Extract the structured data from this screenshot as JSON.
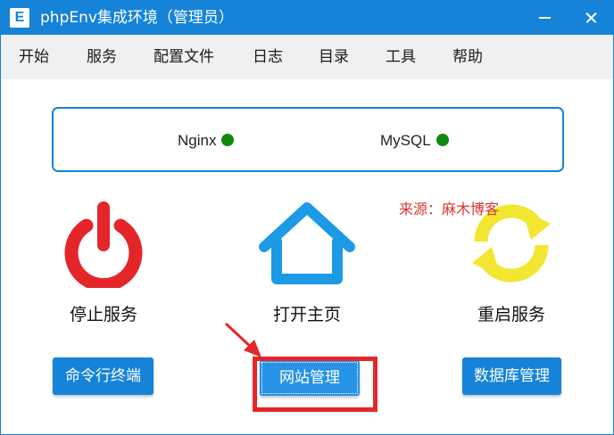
{
  "window": {
    "title": "phpEnv集成环境（管理员）",
    "app_icon_letter": "E"
  },
  "menu": {
    "items": [
      "开始",
      "服务",
      "配置文件",
      "日志",
      "目录",
      "工具",
      "帮助"
    ]
  },
  "services": [
    {
      "name": "Nginx",
      "status": "running",
      "status_color": "#108a0e"
    },
    {
      "name": "MySQL",
      "status": "running",
      "status_color": "#108a0e"
    }
  ],
  "actions": {
    "stop": {
      "label": "停止服务",
      "icon": "power-icon",
      "color": "#e4262a"
    },
    "home": {
      "label": "打开主页",
      "icon": "home-icon",
      "color": "#1583d8"
    },
    "restart": {
      "label": "重启服务",
      "icon": "refresh-icon",
      "color": "#f2e630"
    }
  },
  "buttons": {
    "cmd": "命令行终端",
    "site": "网站管理",
    "db": "数据库管理"
  },
  "watermark": "来源：麻木博客",
  "colors": {
    "accent": "#1583d8",
    "annotation": "#e4262a"
  }
}
